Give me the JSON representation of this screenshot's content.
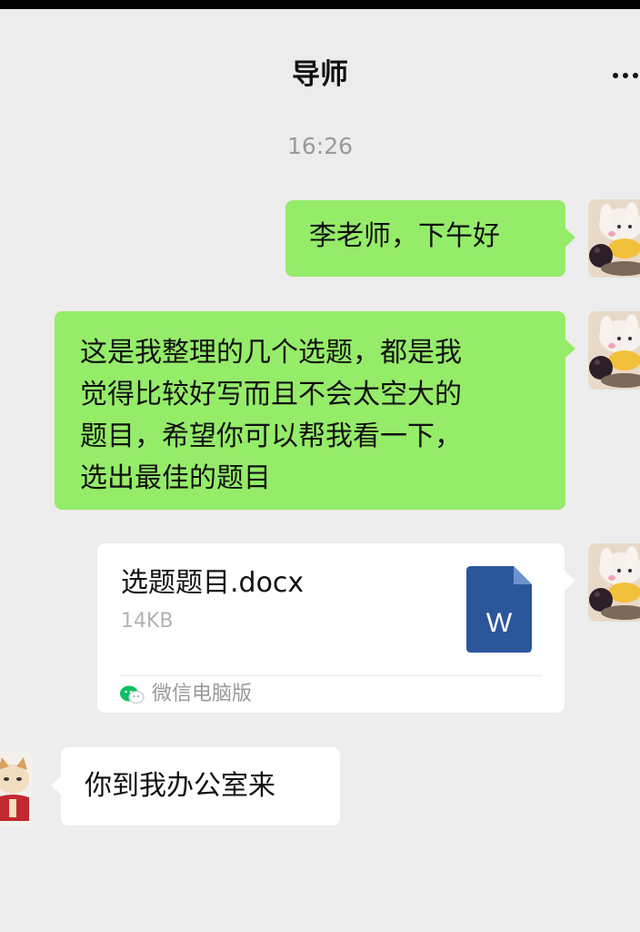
{
  "header": {
    "title": "导师",
    "more_icon": "more-dots-icon"
  },
  "timestamp": "16:26",
  "messages": [
    {
      "sender": "self",
      "type": "text",
      "text": "李老师，下午好"
    },
    {
      "sender": "self",
      "type": "text",
      "lines": [
        "这是我整理的几个选题，都是我",
        "觉得比较好写而且不会太空大的",
        "题目，希望你可以帮我看一下，",
        "选出最佳的题目"
      ]
    },
    {
      "sender": "self",
      "type": "file",
      "file_name": "选题题目.docx",
      "file_size": "14KB",
      "file_icon": "word-document-icon",
      "file_icon_letter": "W",
      "source": "微信电脑版"
    },
    {
      "sender": "other",
      "type": "text",
      "text": "你到我办公室来"
    }
  ],
  "colors": {
    "background": "#ededed",
    "self_bubble": "#95ec69",
    "other_bubble": "#ffffff",
    "word_icon": "#2b579a",
    "wechat_green": "#07c160"
  }
}
